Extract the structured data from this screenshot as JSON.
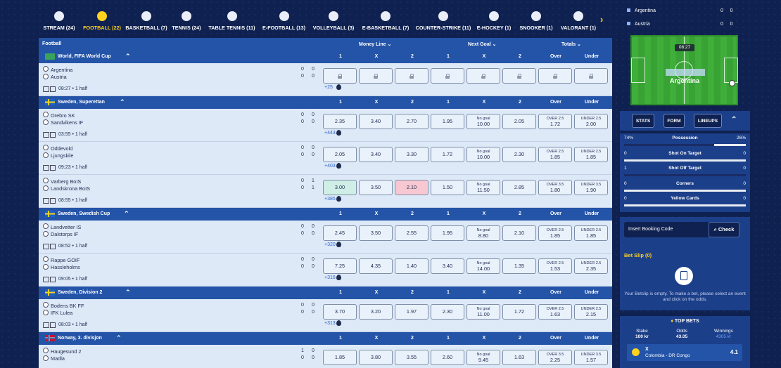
{
  "sports": [
    {
      "label": "STREAM (24)",
      "icon": "play-icon"
    },
    {
      "label": "FOOTBALL (22)",
      "icon": "football-icon",
      "active": true
    },
    {
      "label": "BASKETBALL (7)",
      "icon": "basketball-icon"
    },
    {
      "label": "TENNIS (24)",
      "icon": "tennis-icon"
    },
    {
      "label": "TABLE TENNIS (11)",
      "icon": "table-tennis-icon"
    },
    {
      "label": "E-FOOTBALL (13)",
      "icon": "efootball-icon"
    },
    {
      "label": "VOLLEYBALL (3)",
      "icon": "volleyball-icon"
    },
    {
      "label": "E-BASKETBALL (7)",
      "icon": "ebasketball-icon"
    },
    {
      "label": "COUNTER-STRIKE (11)",
      "icon": "counter-strike-icon"
    },
    {
      "label": "E-HOCKEY (1)",
      "icon": "ehockey-icon"
    },
    {
      "label": "SNOOKER (1)",
      "icon": "snooker-icon"
    },
    {
      "label": "VALORANT (1)",
      "icon": "valorant-icon"
    }
  ],
  "table_header": {
    "title": "Football",
    "money_line": "Money Line",
    "next_goal": "Next Goal",
    "totals": "Totals"
  },
  "groups": [
    {
      "name": "World, FIFA World Cup",
      "cols": [
        "1",
        "X",
        "2",
        "1",
        "X",
        "2",
        "Over",
        "Under"
      ],
      "matches": [
        {
          "home": "Argentina",
          "away": "Austria",
          "hs": [
            "0",
            "0"
          ],
          "as": [
            "0",
            "0"
          ],
          "time": "08:27 • 1 half",
          "more": "+25",
          "locked": true,
          "odds": []
        }
      ]
    },
    {
      "name": "Sweden, Superettan",
      "cols": [
        "1",
        "X",
        "2",
        "1",
        "X",
        "2",
        "Over",
        "Under"
      ],
      "matches": [
        {
          "home": "Orebro SK",
          "away": "Sandvikens IF",
          "hs": [
            "0",
            "0"
          ],
          "as": [
            "0",
            "0"
          ],
          "time": "03:55 • 1 half",
          "more": "+443",
          "odds": [
            {
              "v": "2.35"
            },
            {
              "v": "3.40"
            },
            {
              "v": "2.70"
            },
            {
              "v": "1.95"
            },
            {
              "t": "No goal",
              "v": "10.00"
            },
            {
              "v": "2.05"
            },
            {
              "t": "OVER 2.5",
              "v": "1.72"
            },
            {
              "t": "UNDER 2.5",
              "v": "2.00"
            }
          ]
        },
        {
          "home": "Oddevold",
          "away": "Ljungskile",
          "hs": [
            "0",
            "0"
          ],
          "as": [
            "0",
            "0"
          ],
          "time": "09:23 • 1 half",
          "more": "+403",
          "odds": [
            {
              "v": "2.05"
            },
            {
              "v": "3.40"
            },
            {
              "v": "3.30"
            },
            {
              "v": "1.72"
            },
            {
              "t": "No goal",
              "v": "10.00"
            },
            {
              "v": "2.30"
            },
            {
              "t": "OVER 2.5",
              "v": "1.85"
            },
            {
              "t": "UNDER 2.5",
              "v": "1.85"
            }
          ]
        },
        {
          "home": "Varberg BoIS",
          "away": "Landskrona BoIS",
          "hs": [
            "0",
            "1"
          ],
          "as": [
            "0",
            "1"
          ],
          "time": "08:55 • 1 half",
          "more": "+385",
          "odds": [
            {
              "v": "3.00",
              "s": "up"
            },
            {
              "v": "3.50"
            },
            {
              "v": "2.10",
              "s": "down"
            },
            {
              "v": "1.50"
            },
            {
              "t": "No goal",
              "v": "11.50"
            },
            {
              "v": "2.85"
            },
            {
              "t": "OVER 3.5",
              "v": "1.80"
            },
            {
              "t": "UNDER 3.5",
              "v": "1.90"
            }
          ]
        }
      ]
    },
    {
      "name": "Sweden, Swedish Cup",
      "cols": [
        "1",
        "X",
        "2",
        "1",
        "X",
        "2",
        "Over",
        "Under"
      ],
      "matches": [
        {
          "home": "Landvetter IS",
          "away": "Dalstorps IF",
          "hs": [
            "0",
            "0"
          ],
          "as": [
            "0",
            "0"
          ],
          "time": "08:52 • 1 half",
          "more": "+320",
          "odds": [
            {
              "v": "2.45"
            },
            {
              "v": "3.50"
            },
            {
              "v": "2.55"
            },
            {
              "v": "1.95"
            },
            {
              "t": "No goal",
              "v": "8.80"
            },
            {
              "v": "2.10"
            },
            {
              "t": "OVER 2.5",
              "v": "1.85"
            },
            {
              "t": "UNDER 2.5",
              "v": "1.85"
            }
          ]
        },
        {
          "home": "Rappe GOIF",
          "away": "Hassleholms",
          "hs": [
            "0",
            "0"
          ],
          "as": [
            "0",
            "0"
          ],
          "time": "09:05 • 1 half",
          "more": "+316",
          "odds": [
            {
              "v": "7.25"
            },
            {
              "v": "4.35"
            },
            {
              "v": "1.40"
            },
            {
              "v": "3.40"
            },
            {
              "t": "No goal",
              "v": "14.00"
            },
            {
              "v": "1.35"
            },
            {
              "t": "OVER 2.5",
              "v": "1.53"
            },
            {
              "t": "UNDER 2.5",
              "v": "2.35"
            }
          ]
        }
      ]
    },
    {
      "name": "Sweden, Division 2",
      "cols": [
        "1",
        "X",
        "2",
        "1",
        "X",
        "2",
        "Over",
        "Under"
      ],
      "matches": [
        {
          "home": "Bodens BK FF",
          "away": "IFK Lulea",
          "hs": [
            "0",
            "0"
          ],
          "as": [
            "0",
            "0"
          ],
          "time": "08:03 • 1 half",
          "more": "+313",
          "odds": [
            {
              "v": "3.70"
            },
            {
              "v": "3.20"
            },
            {
              "v": "1.97"
            },
            {
              "v": "2.30"
            },
            {
              "t": "No goal",
              "v": "11.00"
            },
            {
              "v": "1.72"
            },
            {
              "t": "OVER 2.5",
              "v": "1.63"
            },
            {
              "t": "UNDER 2.5",
              "v": "2.15"
            }
          ]
        }
      ]
    },
    {
      "name": "Norway, 3. divisjon",
      "cols": [
        "1",
        "X",
        "2",
        "1",
        "X",
        "2",
        "Over",
        "Under"
      ],
      "matches": [
        {
          "home": "Haugesund 2",
          "away": "Madla",
          "hs": [
            "1",
            "0"
          ],
          "as": [
            "0",
            "0"
          ],
          "time": "",
          "more": "",
          "odds": [
            {
              "v": "1.85"
            },
            {
              "v": "3.80"
            },
            {
              "v": "3.55"
            },
            {
              "v": "2.60"
            },
            {
              "t": "No goal",
              "v": "9.45"
            },
            {
              "v": "1.63"
            },
            {
              "t": "OVER 3.5",
              "v": "2.25"
            },
            {
              "t": "UNDER 3.5",
              "v": "1.57"
            }
          ]
        }
      ]
    }
  ],
  "live": {
    "home": "Argentina",
    "away": "Austria",
    "home_score": [
      "0",
      "0"
    ],
    "away_score": [
      "0",
      "0"
    ],
    "clock": "08:27",
    "field_team": "Argentina"
  },
  "stat_tabs": [
    "STATS",
    "FORM",
    "LINEUPS"
  ],
  "stats": [
    {
      "label": "Possession",
      "left": "74%",
      "right": "26%",
      "fill": 0.74
    },
    {
      "label": "Shot On Target",
      "left": "0",
      "right": "0",
      "fill": 0
    },
    {
      "label": "Shot Off Target",
      "left": "1",
      "right": "0",
      "fill": 1
    },
    {
      "label": "Corners",
      "left": "0",
      "right": "0",
      "fill": 0
    },
    {
      "label": "Yellow Cards",
      "left": "0",
      "right": "0",
      "fill": 0
    }
  ],
  "booking": {
    "placeholder": "Insert Booking Code",
    "button": "Check"
  },
  "betslip": {
    "title": "Bet Slip (0)",
    "message": "Your Betslip is empty. To make a bet, please select an event and click on the odds."
  },
  "topbets": {
    "title": "TOP BETS",
    "stake_label": "Stake",
    "stake": "100 kr",
    "odds_label": "Odds",
    "odds": "43.05",
    "win_label": "Winnings",
    "win": "4305 kr",
    "item": {
      "pick": "X",
      "match": "Colombia - DR Congo",
      "odd": "4.1"
    }
  }
}
